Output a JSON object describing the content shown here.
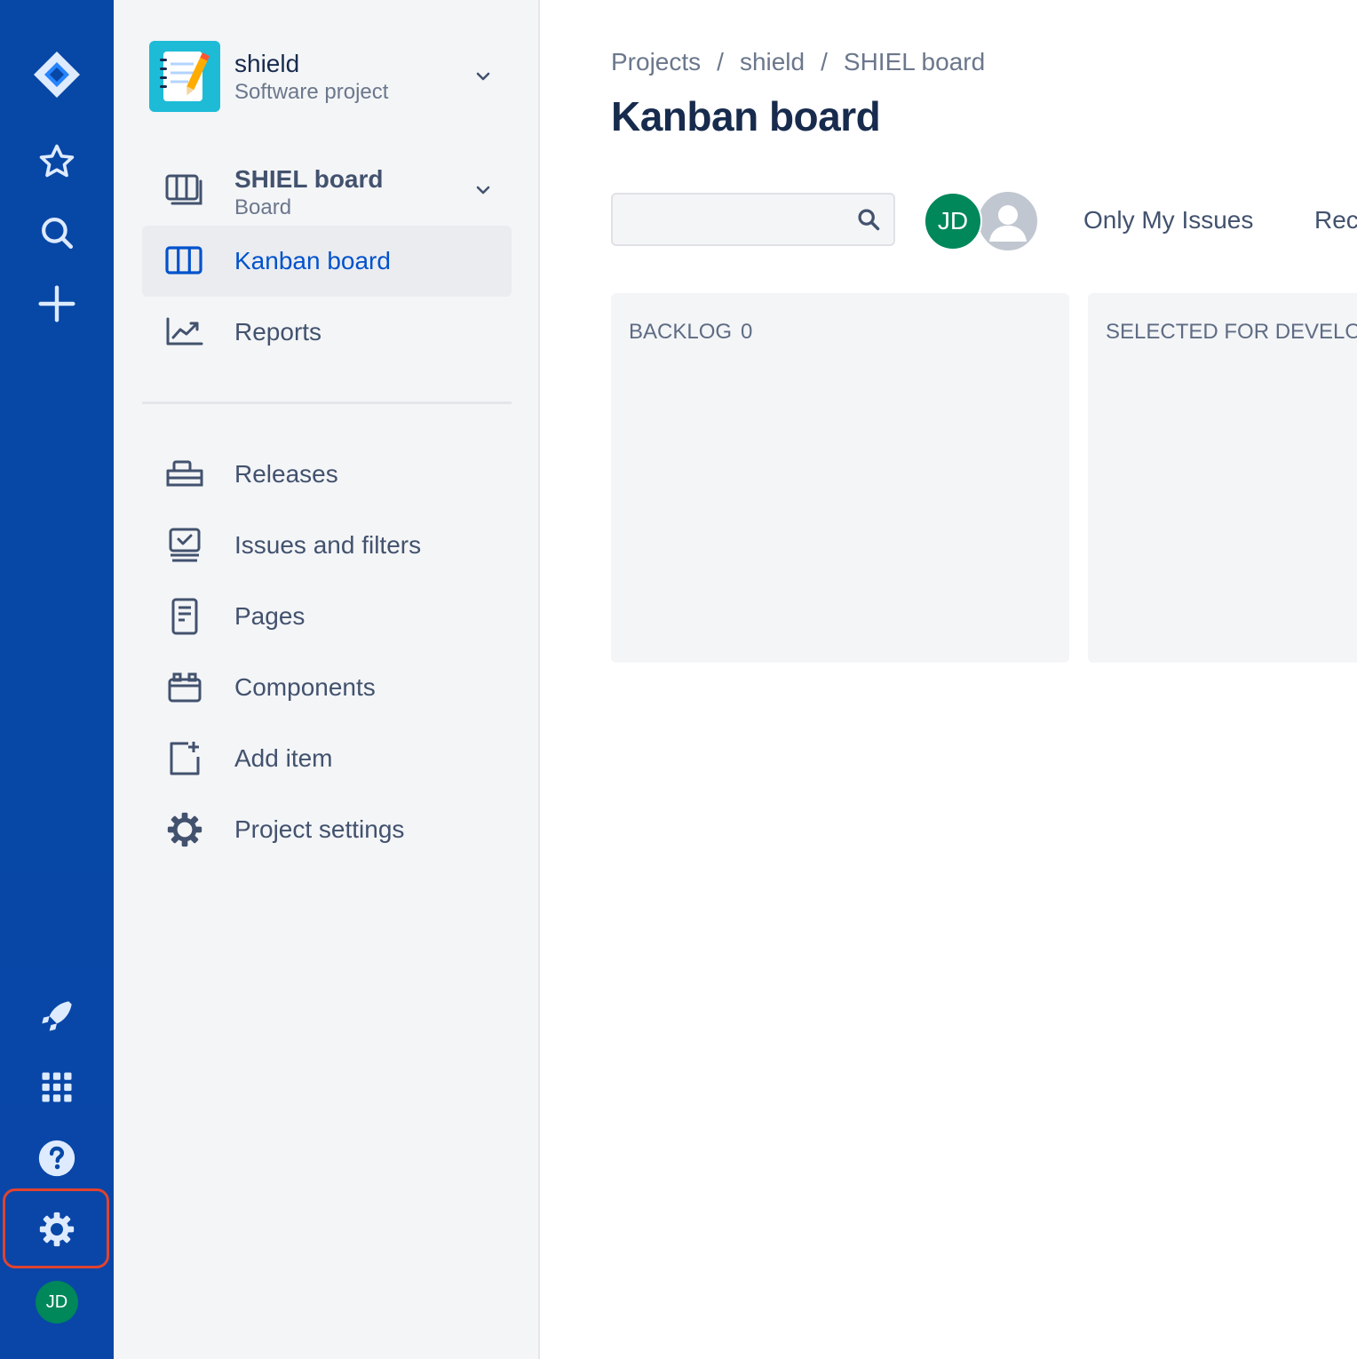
{
  "global_nav": {
    "items": [
      {
        "icon": "jira-logo-icon"
      },
      {
        "icon": "star-icon"
      },
      {
        "icon": "search-icon"
      },
      {
        "icon": "plus-icon"
      },
      {
        "icon": "rocket-icon"
      },
      {
        "icon": "app-switcher-icon"
      },
      {
        "icon": "help-icon"
      },
      {
        "icon": "settings-gear-icon"
      }
    ],
    "user_initials": "JD",
    "highlight_color": "#e0432f",
    "background_color": "#0747a6"
  },
  "project": {
    "name": "shield",
    "type": "Software project",
    "avatar_color": "#1ebbd7"
  },
  "board": {
    "name": "SHIEL board",
    "subtitle": "Board"
  },
  "sidebar": {
    "primary_items": [
      {
        "label": "Kanban board",
        "icon": "board-columns-icon",
        "active": true
      },
      {
        "label": "Reports",
        "icon": "reports-chart-icon",
        "active": false
      }
    ],
    "secondary_items": [
      {
        "label": "Releases",
        "icon": "ship-icon"
      },
      {
        "label": "Issues and filters",
        "icon": "issues-icon"
      },
      {
        "label": "Pages",
        "icon": "page-icon"
      },
      {
        "label": "Components",
        "icon": "component-icon"
      },
      {
        "label": "Add item",
        "icon": "add-item-icon"
      },
      {
        "label": "Project settings",
        "icon": "settings-gear-icon"
      }
    ],
    "active_color": "#0052cc"
  },
  "breadcrumbs": [
    "Projects",
    "shield",
    "SHIEL board"
  ],
  "breadcrumb_separator": "/",
  "page_title": "Kanban board",
  "search": {
    "value": "",
    "placeholder": ""
  },
  "filters": {
    "avatar_initials": "JD",
    "only_my_issues": "Only My Issues",
    "recently_updated": "Rec"
  },
  "columns": [
    {
      "name": "BACKLOG",
      "count": "0"
    },
    {
      "name": "SELECTED FOR DEVELOP",
      "count": ""
    }
  ]
}
